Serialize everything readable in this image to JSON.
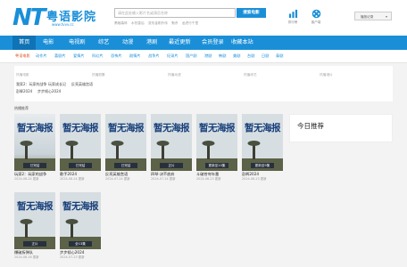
{
  "header": {
    "logo_mark": "NT",
    "site_name": "粤语影院",
    "site_url": "www.tvvv.cc",
    "search_placeholder": "请在此处输入影片名或演员名称",
    "search_button": "搜索电影",
    "hot_words": [
      "黑暗森林",
      "水饺皇后",
      "变形金刚外传",
      "默杀",
      "龙虎行千里"
    ],
    "rank_label": "排行榜",
    "app_label": "客户端",
    "history_label": "播放记录",
    "brand_color": "#1a8fd8"
  },
  "nav": {
    "items": [
      "首页",
      "电影",
      "电视剧",
      "综艺",
      "动漫",
      "港剧",
      "最近更新",
      "会员登录",
      "收藏本站"
    ]
  },
  "subnav": {
    "items": [
      "粤语电影",
      "动作片",
      "喜剧片",
      "爱情片",
      "科幻片",
      "恐怖片",
      "剧情片",
      "战争片",
      "纪录片",
      "国产剧",
      "港剧",
      "韩剧",
      "美剧",
      "台剧",
      "日剧",
      "泰剧"
    ]
  },
  "links_panel": {
    "columns": [
      "热播电影",
      "热播剧集",
      "热播动漫",
      "热播综艺",
      "热播港片"
    ],
    "links_row1": [
      "我家2：玩家的战争",
      "玩家成长记",
      "反亮英雄宫语"
    ],
    "links_row2": [
      "彭辉2024",
      "步步倾心2024"
    ]
  },
  "section": {
    "title": "热播推荐"
  },
  "movies": [
    {
      "poster_text": "暂无海报",
      "badge": "已完结",
      "title": "玩家2：玩家的战争",
      "date": "2024-08-24 更新"
    },
    {
      "poster_text": "暂无海报",
      "badge": "已完结",
      "title": "歌手2024",
      "date": "2024-08-24 更新"
    },
    {
      "poster_text": "暂无海报",
      "badge": "已完结",
      "title": "反亮英雄宫语",
      "date": "2024-07-24 更新"
    },
    {
      "poster_text": "暂无海报",
      "badge": "正片",
      "title": "四琴·决不放弃",
      "date": "2024-07-24 更新"
    },
    {
      "poster_text": "暂无海报",
      "badge": "更新至10集",
      "title": "斗破苍穹年番",
      "date": "2024-08-23 更新"
    },
    {
      "poster_text": "暂无海报",
      "badge": "更新至9集",
      "title": "彭辉2024",
      "date": "2024-08-23 更新"
    },
    {
      "poster_text": "暂无海报",
      "badge": "正片",
      "title": "爆破拆弹队",
      "date": "2024-08-16 更新"
    },
    {
      "poster_text": "暂无海报",
      "badge": "全13集",
      "title": "步步倾心2024",
      "date": "2024-07-23 更新"
    }
  ],
  "side": {
    "title": "今日推荐"
  }
}
